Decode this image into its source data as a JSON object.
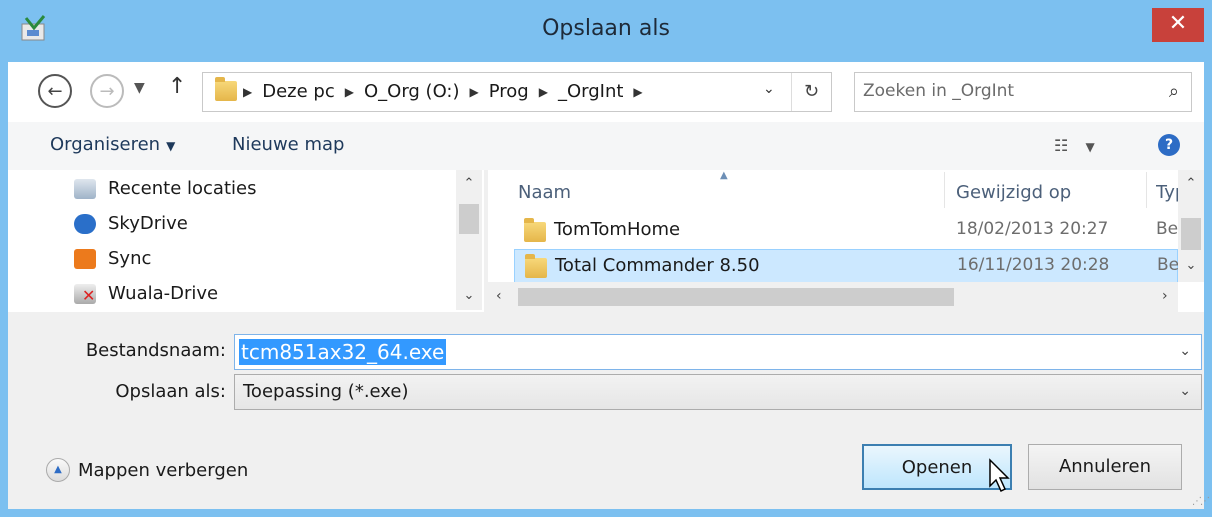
{
  "window": {
    "title": "Opslaan als",
    "close_symbol": "✕"
  },
  "address": {
    "crumbs": [
      "Deze pc",
      "O_Org (O:)",
      "Prog",
      "_OrgInt"
    ],
    "search_placeholder": "Zoeken in _OrgInt"
  },
  "toolbar": {
    "organize_label": "Organiseren",
    "new_folder_label": "Nieuwe map"
  },
  "nav_pane": {
    "items": [
      {
        "label": "Recente locaties",
        "icon": "recent-places-icon"
      },
      {
        "label": "SkyDrive",
        "icon": "skydrive-icon"
      },
      {
        "label": "Sync",
        "icon": "sync-icon"
      },
      {
        "label": "Wuala-Drive",
        "icon": "network-drive-icon"
      }
    ]
  },
  "file_list": {
    "columns": {
      "name": "Naam",
      "modified": "Gewijzigd op",
      "type": "Type"
    },
    "rows": [
      {
        "name": "TomTomHome",
        "modified": "18/02/2013 20:27",
        "type": "Bestandsmap",
        "selected": false
      },
      {
        "name": "Total Commander 8.50",
        "modified": "16/11/2013 20:28",
        "type": "Bestandsmap",
        "selected": true
      }
    ]
  },
  "form": {
    "filename_label": "Bestandsnaam:",
    "filename_value": "tcm851ax32_64.exe",
    "filetype_label": "Opslaan als:",
    "filetype_value": "Toepassing (*.exe)"
  },
  "footer": {
    "hide_folders_label": "Mappen verbergen",
    "open_label": "Openen",
    "cancel_label": "Annuleren"
  },
  "colors": {
    "titlebar": "#7cc0f0",
    "close": "#c8413b",
    "selection": "#cce8ff",
    "text_selection": "#3399ff"
  }
}
